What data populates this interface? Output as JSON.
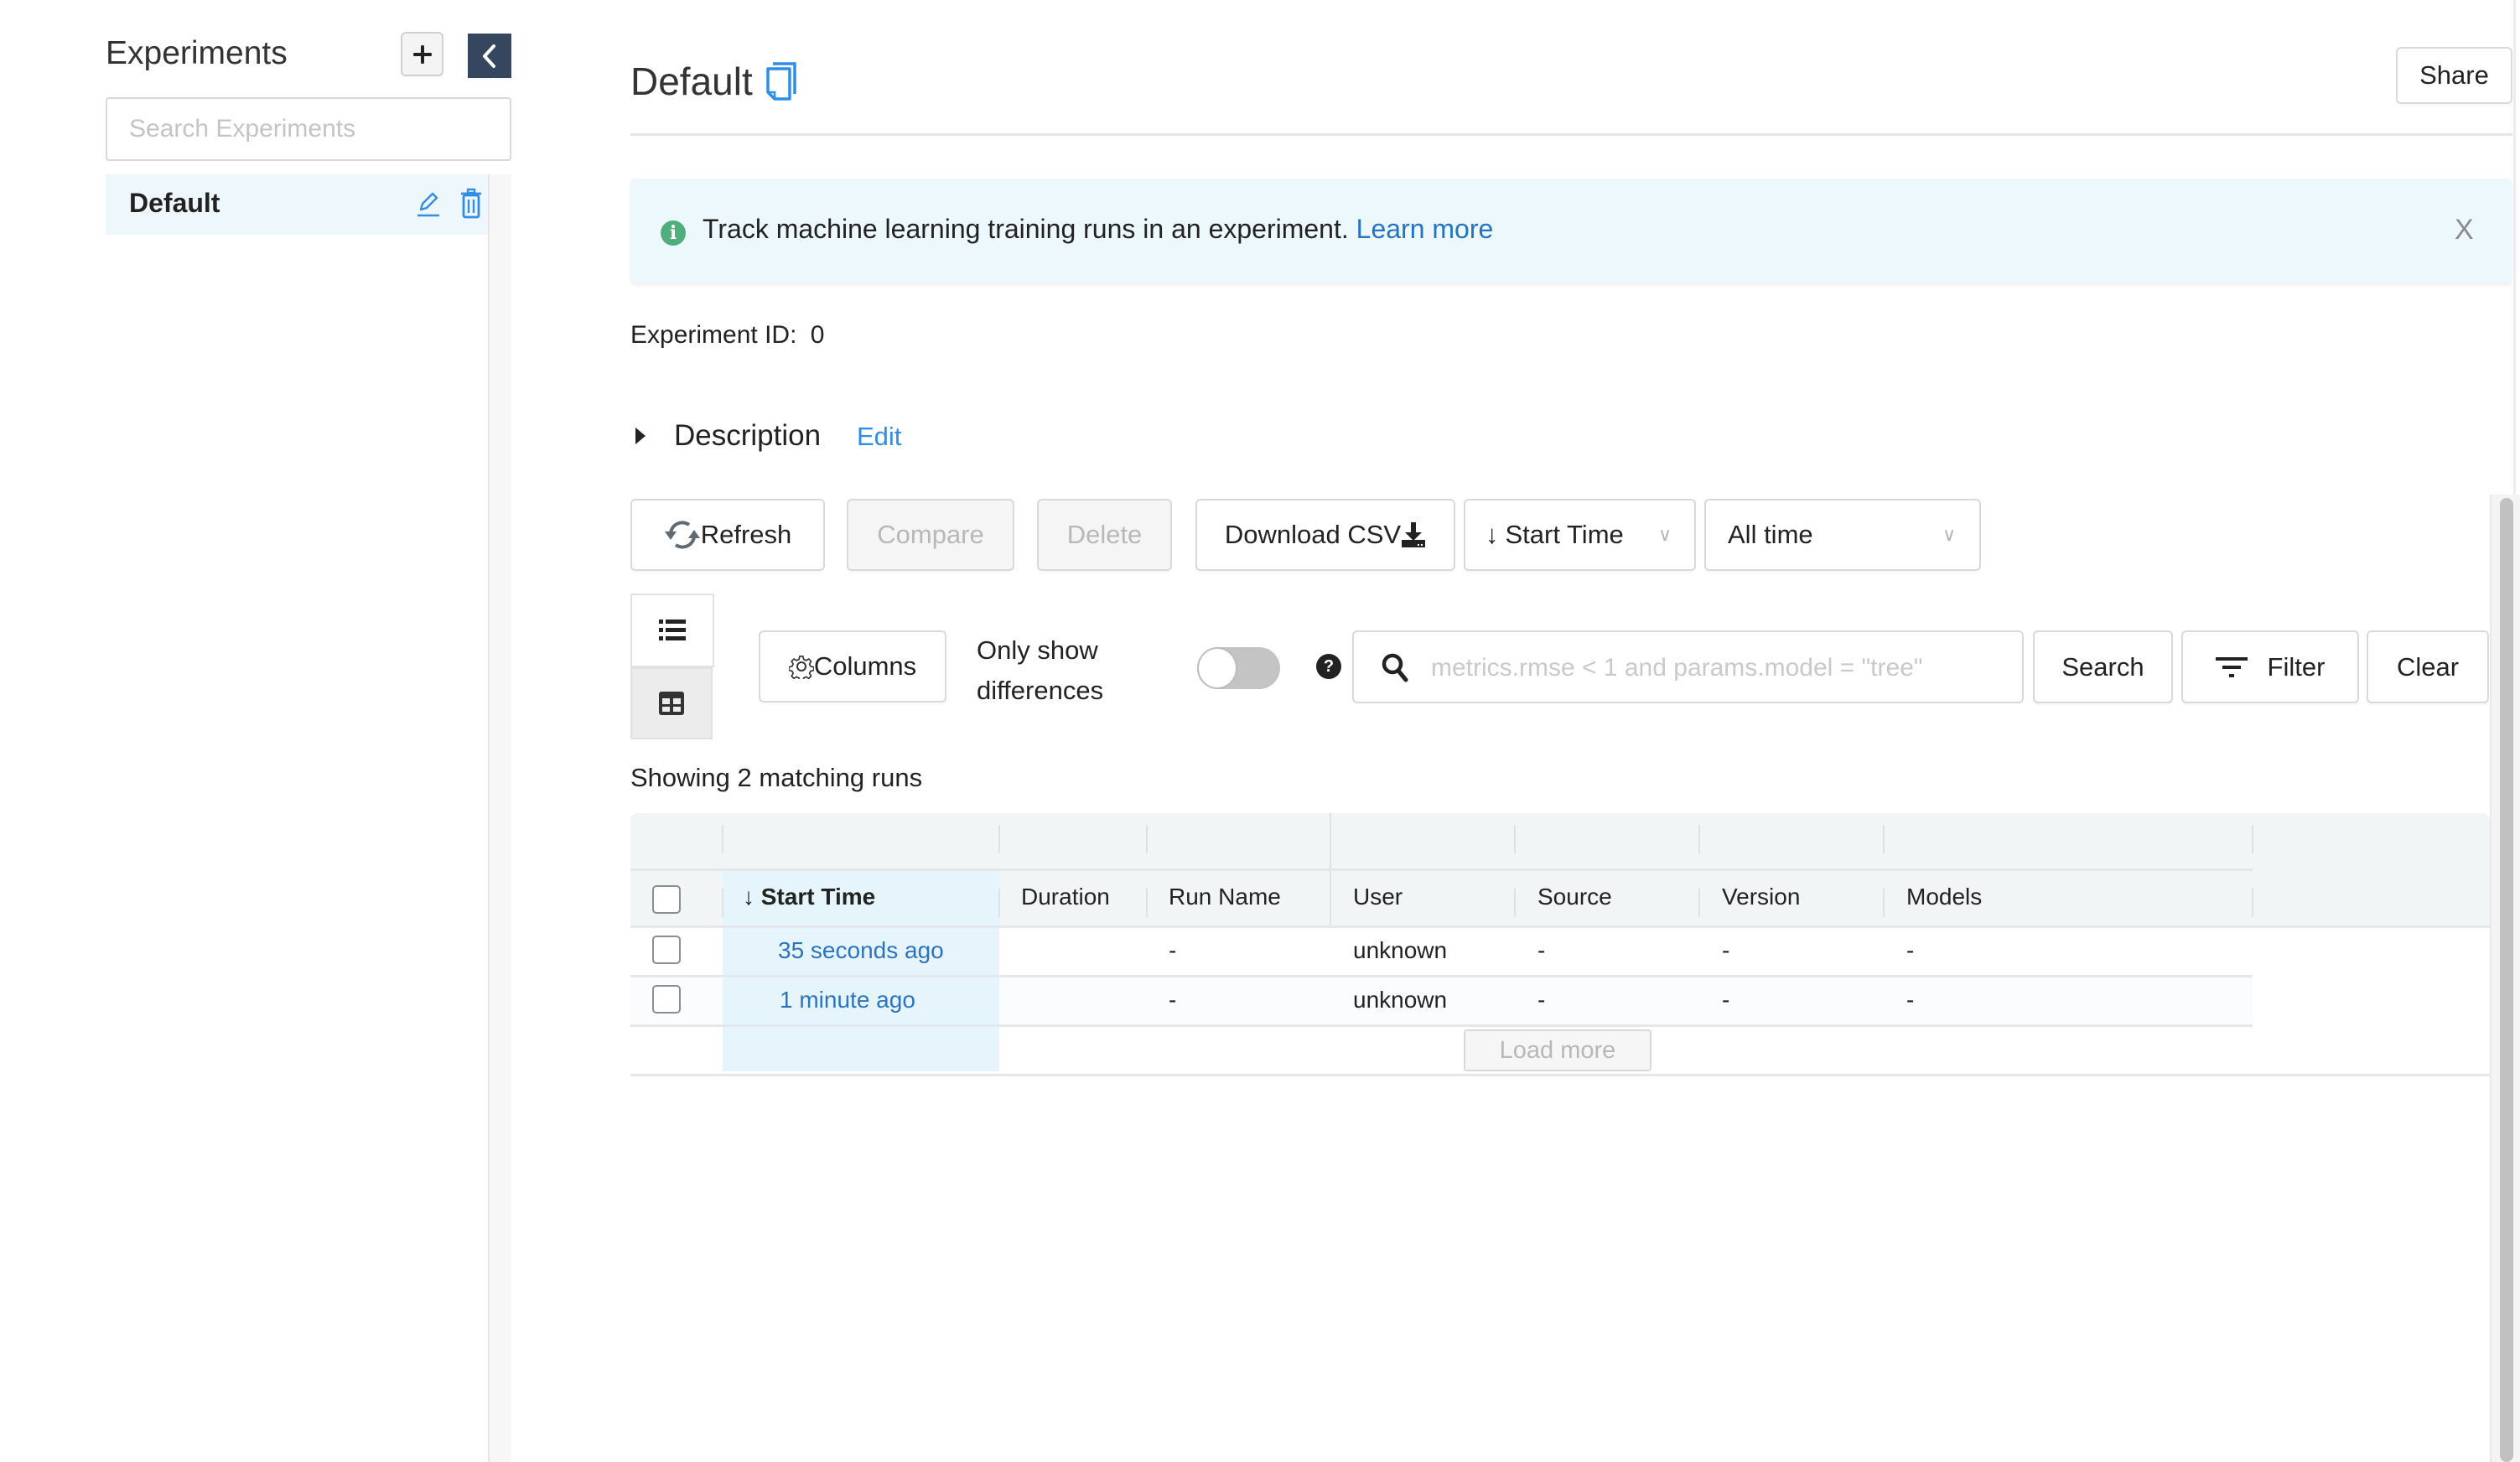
{
  "sidebar": {
    "title": "Experiments",
    "add_button": "+",
    "collapse_icon": "chevron-left-icon",
    "search_placeholder": "Search Experiments",
    "search_value": "",
    "experiments": [
      {
        "name": "Default",
        "selected": true,
        "actions": [
          "edit-icon",
          "trash-icon"
        ]
      }
    ]
  },
  "header": {
    "title": "Default",
    "copy_icon": "copy-icon",
    "share_label": "Share"
  },
  "banner": {
    "icon": "info-icon",
    "icon_glyph": "i",
    "text": "Track machine learning training runs in an experiment.",
    "link": "Learn more",
    "close": "X"
  },
  "experiment_id": {
    "label": "Experiment ID:",
    "value": "0"
  },
  "description": {
    "label": "Description",
    "edit": "Edit"
  },
  "toolbar": {
    "refresh": "Refresh",
    "compare": "Compare",
    "delete": "Delete",
    "download_csv": "Download CSV",
    "sort_label": "Start Time",
    "sort_arrow": "↓",
    "time_filter": "All time",
    "chevron": "∨"
  },
  "search_row": {
    "columns": "Columns",
    "only_show_line1": "Only show",
    "only_show_line2": "differences",
    "toggle_on": false,
    "help": "?",
    "search_placeholder": "metrics.rmse < 1 and params.model = \"tree\"",
    "search_value": "",
    "search_btn": "Search",
    "filter_btn": "Filter",
    "clear_btn": "Clear"
  },
  "results": {
    "showing": "Showing 2 matching runs"
  },
  "table": {
    "columns": [
      "↓ Start Time",
      "Duration",
      "Run Name",
      "User",
      "Source",
      "Version",
      "Models"
    ],
    "rows": [
      {
        "start_time": "35 seconds ago",
        "duration": "",
        "run_name": "-",
        "user": "unknown",
        "source": "-",
        "version": "-",
        "models": "-"
      },
      {
        "start_time": "1 minute ago",
        "duration": "",
        "run_name": "-",
        "user": "unknown",
        "source": "-",
        "version": "-",
        "models": "-"
      }
    ],
    "load_more": "Load more"
  },
  "colors": {
    "accent_blue": "#2f8ee8",
    "link_blue": "#2474c4",
    "sidebar_collapse_bg": "#34475f",
    "banner_bg": "#edf8fc",
    "info_green": "#4fae7c",
    "selected_row_bg": "#eef7fb"
  }
}
